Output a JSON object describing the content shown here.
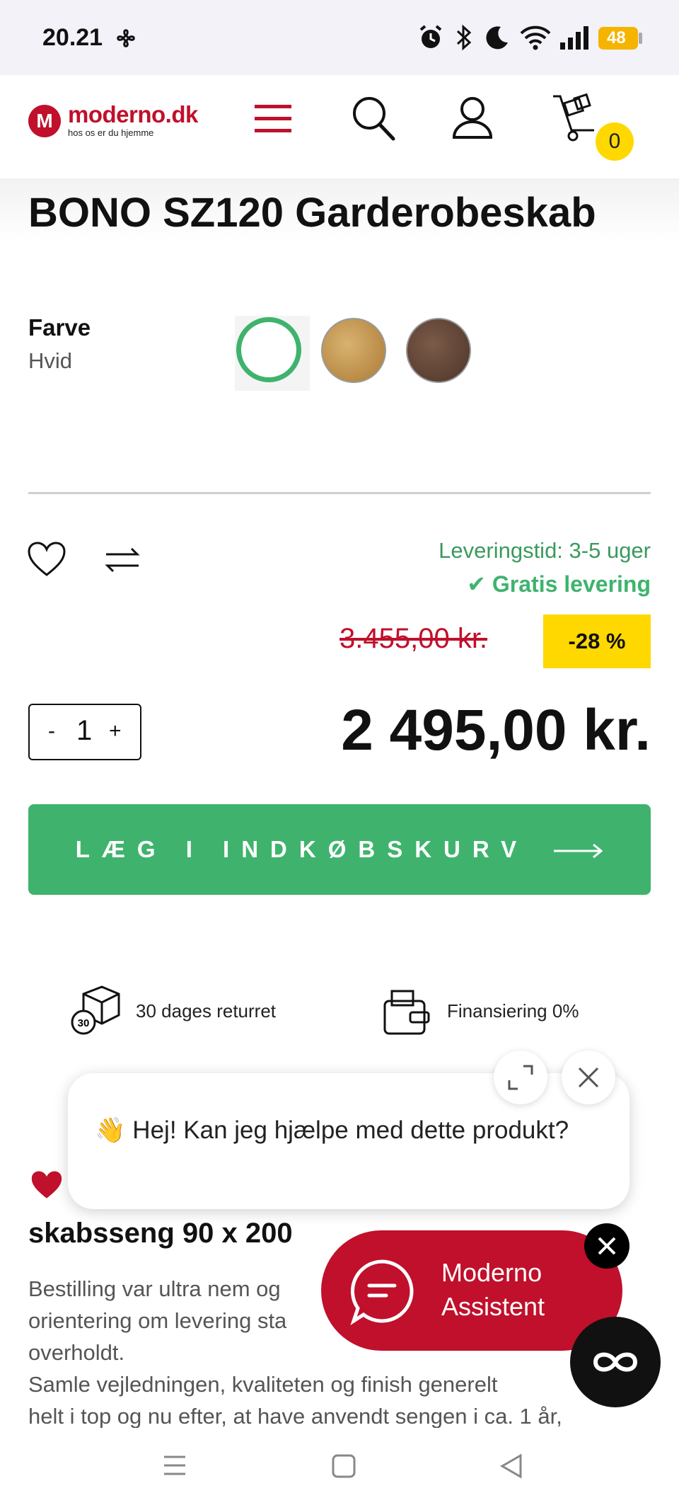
{
  "status_bar": {
    "time": "20.21",
    "battery": "48"
  },
  "header": {
    "logo_text": "moderno.dk",
    "logo_tagline": "hos os er du hjemme",
    "cart_count": "0"
  },
  "product": {
    "title": "BONO SZ120 Garderobeskab",
    "color_label": "Farve",
    "color_value": "Hvid",
    "delivery_time": "Leveringstid: 3-5 uger",
    "free_delivery": "✔ Gratis levering",
    "old_price": "3.455,00 kr.",
    "discount": "-28 %",
    "quantity": "1",
    "qty_minus": "-",
    "qty_plus": "+",
    "price": "2 495,00 kr.",
    "add_to_cart": "LÆG I INDKØBSKURV"
  },
  "features": {
    "returns": "30 dages returret",
    "returns_badge": "30",
    "financing": "Finansiering 0%"
  },
  "chat": {
    "greeting": "👋 Hej! Kan jeg hjælpe med dette produkt?",
    "assistant_line1": "Moderno",
    "assistant_line2": "Assistent"
  },
  "review": {
    "title": "skabsseng 90 x 200",
    "line1": "Bestilling var ultra nem og",
    "line2": "orientering om levering sta",
    "line3": "overholdt.",
    "line4": "Samle vejledningen, kvaliteten og finish generelt",
    "line5": "helt i top og nu efter, at have anvendt sengen i ca. 1 år,"
  },
  "colors": {
    "brand_red": "#c0102b",
    "accent_green": "#3fb36d",
    "badge_yellow": "#ffd800"
  }
}
